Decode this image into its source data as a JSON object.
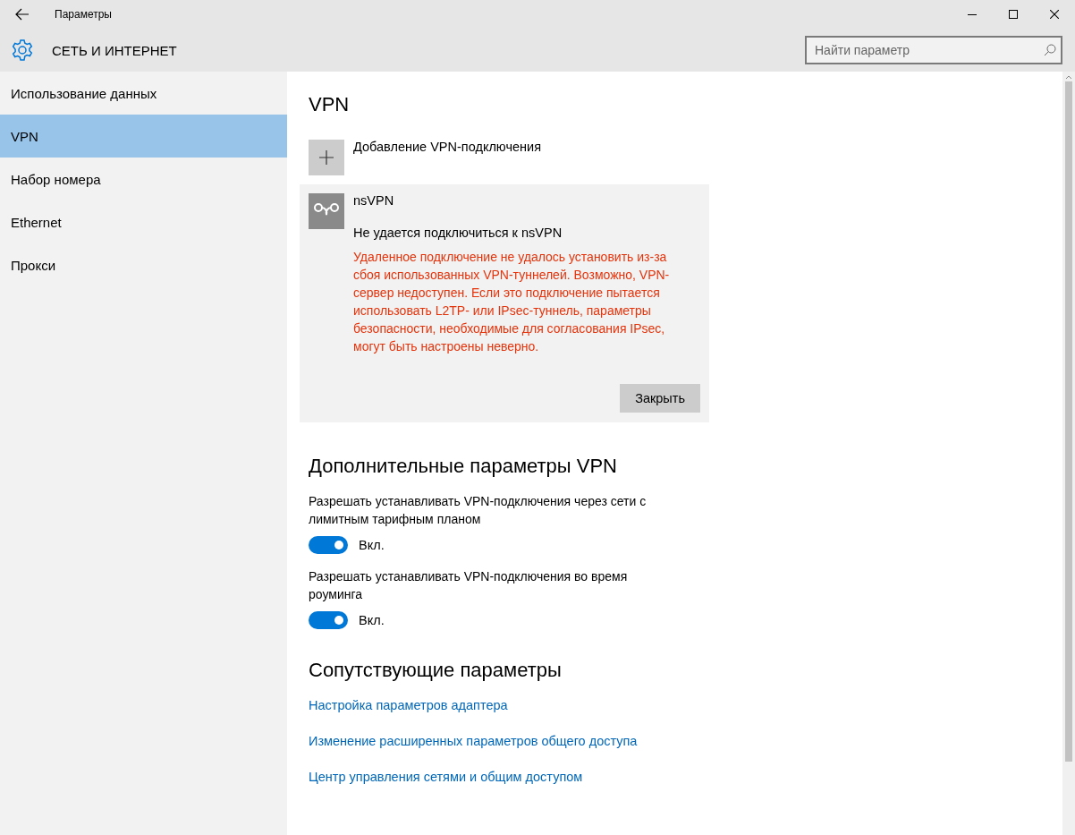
{
  "window": {
    "title": "Параметры"
  },
  "header": {
    "title": "СЕТЬ И ИНТЕРНЕТ",
    "search": {
      "placeholder": "Найти параметр"
    }
  },
  "sidebar": {
    "items": [
      {
        "label": "Использование данных",
        "selected": false
      },
      {
        "label": "VPN",
        "selected": true
      },
      {
        "label": "Набор номера",
        "selected": false
      },
      {
        "label": "Ethernet",
        "selected": false
      },
      {
        "label": "Прокси",
        "selected": false
      }
    ]
  },
  "vpn": {
    "title": "VPN",
    "add_label": "Добавление VPN-подключения",
    "connections": [
      {
        "name": "nsVPN",
        "status": "Не удается подключиться к nsVPN",
        "error": "Удаленное подключение не удалось установить из-за сбоя использованных VPN-туннелей. Возможно, VPN-сервер недоступен. Если это подключение пытается использовать L2TP- или IPsec-туннель, параметры безопасности, необходимые для согласования IPsec, могут быть настроены неверно.",
        "button": "Закрыть"
      }
    ]
  },
  "advanced": {
    "title": "Дополнительные параметры VPN",
    "settings": [
      {
        "label": "Разрешать устанавливать VPN-подключения через сети с лимитным тарифным планом",
        "on": true,
        "state_label": "Вкл."
      },
      {
        "label": "Разрешать устанавливать VPN-подключения во время роуминга",
        "on": true,
        "state_label": "Вкл."
      }
    ]
  },
  "related": {
    "title": "Сопутствующие параметры",
    "links": [
      "Настройка параметров адаптера",
      "Изменение расширенных параметров общего доступа",
      "Центр управления сетями и общим доступом"
    ]
  }
}
